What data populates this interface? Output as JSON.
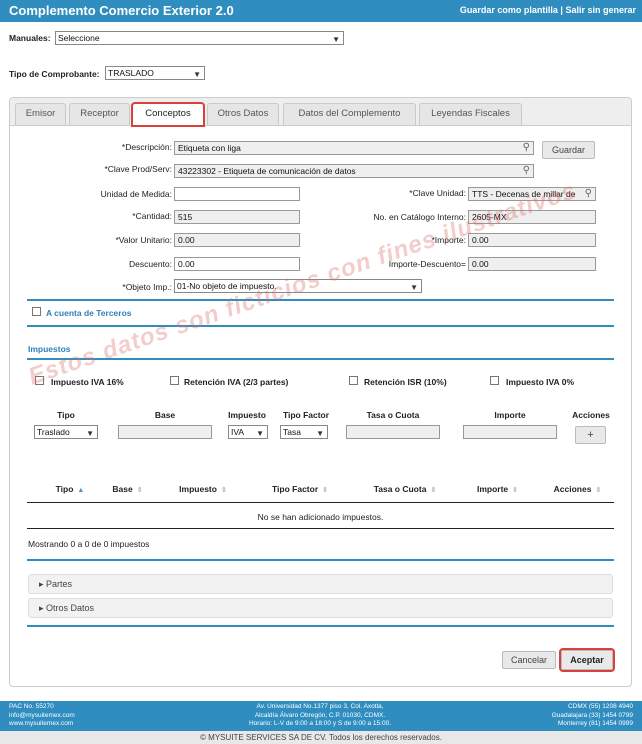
{
  "header": {
    "title": "Complemento Comercio Exterior 2.0",
    "save_template": "Guardar como plantilla",
    "separator": "|",
    "exit": "Salir sin generar"
  },
  "manuales": {
    "label": "Manuales:",
    "value": "Seleccione"
  },
  "tipo_comprobante": {
    "label": "Tipo de Comprobante:",
    "value": "TRASLADO"
  },
  "tabs": [
    {
      "label": "Emisor"
    },
    {
      "label": "Receptor"
    },
    {
      "label": "Conceptos"
    },
    {
      "label": "Otros Datos"
    },
    {
      "label": "Datos del Complemento"
    },
    {
      "label": "Leyendas Fiscales"
    }
  ],
  "form": {
    "descripcion": {
      "label": "*Descripción:",
      "value": "Etiqueta con liga"
    },
    "guardar": "Guardar",
    "clave_prod": {
      "label": "*Clave Prod/Serv:",
      "value": "43223302 - Etiqueta de comunicación de datos"
    },
    "unidad_medida": {
      "label": "Unidad de Medida:",
      "value": ""
    },
    "clave_unidad": {
      "label": "*Clave Unidad:",
      "value": "TTS - Decenas de millar de"
    },
    "cantidad": {
      "label": "*Cantidad:",
      "value": "515"
    },
    "no_catalogo": {
      "label": "No. en Catálogo Interno:",
      "value": "2605-MX"
    },
    "valor_unitario": {
      "label": "*Valor Unitario:",
      "value": "0.00"
    },
    "importe": {
      "label": "*Importe:",
      "value": "0.00"
    },
    "descuento": {
      "label": "Descuento:",
      "value": "0.00"
    },
    "importe_descuento": {
      "label": "Importe-Descuento=",
      "value": "0.00"
    },
    "objeto_imp": {
      "label": "*Objeto Imp.:",
      "value": "01-No objeto de impuesto."
    },
    "terceros": "A cuenta de Terceros"
  },
  "impuestos": {
    "title": "Impuestos",
    "checks": [
      "Impuesto IVA 16%",
      "Retención IVA (2/3 partes)",
      "Retención ISR (10%)",
      "Impuesto IVA 0%"
    ],
    "entry_headers": [
      "Tipo",
      "Base",
      "Impuesto",
      "Tipo Factor",
      "Tasa o Cuota",
      "Importe",
      "Acciones"
    ],
    "tipo_value": "Traslado",
    "impuesto_value": "IVA",
    "factor_value": "Tasa",
    "add": "+",
    "table_headers": [
      "Tipo",
      "Base",
      "Impuesto",
      "Tipo Factor",
      "Tasa o Cuota",
      "Importe",
      "Acciones"
    ],
    "empty": "No se han adicionado impuestos.",
    "showing": "Mostrando 0 a 0 de 0 impuestos"
  },
  "accordions": {
    "partes": "Partes",
    "otros_datos": "Otros Datos"
  },
  "actions": {
    "cancel": "Cancelar",
    "accept": "Aceptar"
  },
  "watermark": "Estos datos son ficticios con fines ilustrativos",
  "footer": {
    "left": [
      "PAC No. 55270",
      "info@mysuitemex.com",
      "www.mysuitemex.com"
    ],
    "center": [
      "Av. Universidad No.1377 piso 3, Col. Axotla,",
      "Alcaldía Álvaro Obregón, C.P. 01030, CDMX.",
      "Horario: L-V de 9:00 a 18:00 y S de 9:00 a 15:00."
    ],
    "right": [
      "CDMX (55) 1208 4940",
      "Guadalajara (33) 1454 0799",
      "Monterrey (81) 1454 0999"
    ],
    "copyright": "© MYSUITE SERVICES SA DE CV. Todos los derechos reservados."
  },
  "colors": {
    "brand": "#2f8dc0",
    "highlight": "#d9403a"
  }
}
